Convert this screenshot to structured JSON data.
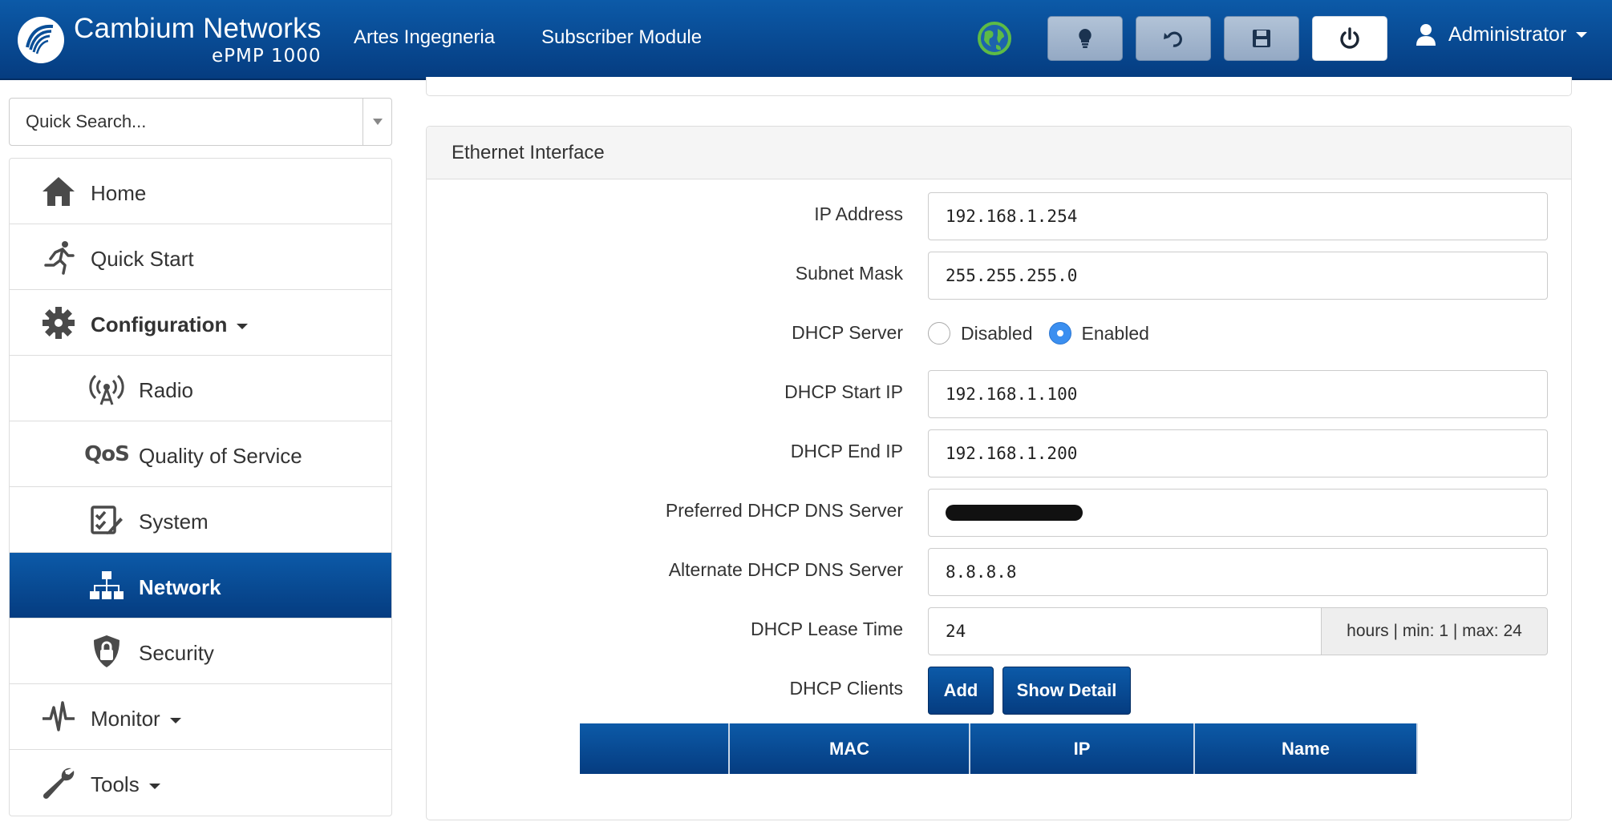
{
  "header": {
    "brand_name": "Cambium Networks",
    "brand_model": "ePMP 1000",
    "site_name": "Artes Ingegneria",
    "device_mode": "Subscriber Module",
    "user_label": "Administrator",
    "accent_color": "#053c80"
  },
  "toolbar": {
    "buttons": [
      {
        "icon": "lightbulb-icon"
      },
      {
        "icon": "undo-icon"
      },
      {
        "icon": "save-icon"
      },
      {
        "icon": "power-icon"
      }
    ]
  },
  "sidebar": {
    "search_placeholder": "Quick Search...",
    "items": [
      {
        "label": "Home",
        "icon": "home-icon"
      },
      {
        "label": "Quick Start",
        "icon": "running-man-icon"
      },
      {
        "label": "Configuration",
        "icon": "gear-icon",
        "expanded": true
      },
      {
        "label": "Radio",
        "icon": "radio-tower-icon"
      },
      {
        "label": "Quality of Service",
        "icon": "qos-icon"
      },
      {
        "label": "System",
        "icon": "system-icon"
      },
      {
        "label": "Network",
        "icon": "network-icon",
        "active": true
      },
      {
        "label": "Security",
        "icon": "lock-icon"
      },
      {
        "label": "Monitor",
        "icon": "pulse-icon"
      },
      {
        "label": "Tools",
        "icon": "wrench-icon"
      }
    ]
  },
  "ethernet": {
    "title": "Ethernet Interface",
    "fields": {
      "ip_address": {
        "label": "IP Address",
        "value": "192.168.1.254"
      },
      "subnet_mask": {
        "label": "Subnet Mask",
        "value": "255.255.255.0"
      },
      "dhcp_server": {
        "label": "DHCP Server",
        "options": [
          "Disabled",
          "Enabled"
        ],
        "selected": "Enabled"
      },
      "dhcp_start": {
        "label": "DHCP Start IP",
        "value": "192.168.1.100"
      },
      "dhcp_end": {
        "label": "DHCP End IP",
        "value": "192.168.1.200"
      },
      "preferred_dns": {
        "label": "Preferred DHCP DNS Server",
        "value": ""
      },
      "alternate_dns": {
        "label": "Alternate DHCP DNS Server",
        "value": "8.8.8.8"
      },
      "lease_time": {
        "label": "DHCP Lease Time",
        "value": "24",
        "unit_hint": "hours | min: 1 | max: 24"
      },
      "dhcp_clients": {
        "label": "DHCP Clients",
        "add_label": "Add",
        "detail_label": "Show Detail"
      }
    },
    "clients_table": {
      "columns": [
        "",
        "MAC",
        "IP",
        "Name"
      ]
    }
  }
}
